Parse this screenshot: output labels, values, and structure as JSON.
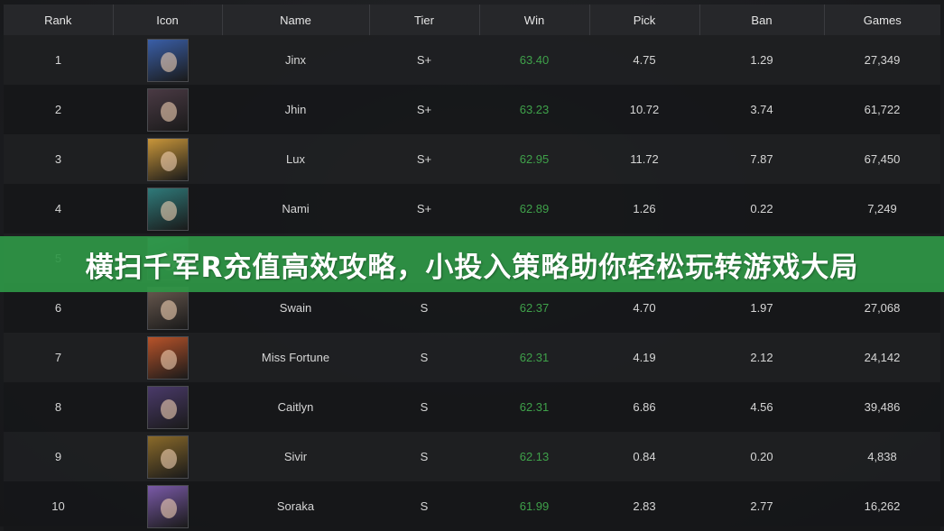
{
  "table": {
    "headers": [
      "Rank",
      "Icon",
      "Name",
      "Tier",
      "Win",
      "Pick",
      "Ban",
      "Games"
    ],
    "rows": [
      {
        "rank": "1",
        "icon": "jinx-portrait-icon",
        "name": "Jinx",
        "tier": "S+",
        "win": "63.40",
        "pick": "4.75",
        "ban": "1.29",
        "games": "27,349"
      },
      {
        "rank": "2",
        "icon": "jhin-portrait-icon",
        "name": "Jhin",
        "tier": "S+",
        "win": "63.23",
        "pick": "10.72",
        "ban": "3.74",
        "games": "61,722"
      },
      {
        "rank": "3",
        "icon": "lux-portrait-icon",
        "name": "Lux",
        "tier": "S+",
        "win": "62.95",
        "pick": "11.72",
        "ban": "7.87",
        "games": "67,450"
      },
      {
        "rank": "4",
        "icon": "nami-portrait-icon",
        "name": "Nami",
        "tier": "S+",
        "win": "62.89",
        "pick": "1.26",
        "ban": "0.22",
        "games": "7,249"
      },
      {
        "rank": "5",
        "icon": "champion-portrait-icon",
        "name": "",
        "tier": "",
        "win": "",
        "pick": "",
        "ban": "",
        "games": ""
      },
      {
        "rank": "6",
        "icon": "swain-portrait-icon",
        "name": "Swain",
        "tier": "S",
        "win": "62.37",
        "pick": "4.70",
        "ban": "1.97",
        "games": "27,068"
      },
      {
        "rank": "7",
        "icon": "miss-fortune-portrait-icon",
        "name": "Miss Fortune",
        "tier": "S",
        "win": "62.31",
        "pick": "4.19",
        "ban": "2.12",
        "games": "24,142"
      },
      {
        "rank": "8",
        "icon": "caitlyn-portrait-icon",
        "name": "Caitlyn",
        "tier": "S",
        "win": "62.31",
        "pick": "6.86",
        "ban": "4.56",
        "games": "39,486"
      },
      {
        "rank": "9",
        "icon": "sivir-portrait-icon",
        "name": "Sivir",
        "tier": "S",
        "win": "62.13",
        "pick": "0.84",
        "ban": "0.20",
        "games": "4,838"
      },
      {
        "rank": "10",
        "icon": "soraka-portrait-icon",
        "name": "Soraka",
        "tier": "S",
        "win": "61.99",
        "pick": "2.83",
        "ban": "2.77",
        "games": "16,262"
      }
    ]
  },
  "banner": {
    "text": "横扫千军R充值高效攻略，小投入策略助你轻松玩转游戏大局"
  },
  "colors": {
    "win_green": "#3fa14a",
    "banner_green": "#2e9646",
    "portraits": [
      "#3a5fa8",
      "#4a3a44",
      "#c9963a",
      "#2f7a7a",
      "#3c9a8a",
      "#6a5a50",
      "#b8532a",
      "#4a3a6a",
      "#8a6a2a",
      "#7a5aa8"
    ]
  }
}
